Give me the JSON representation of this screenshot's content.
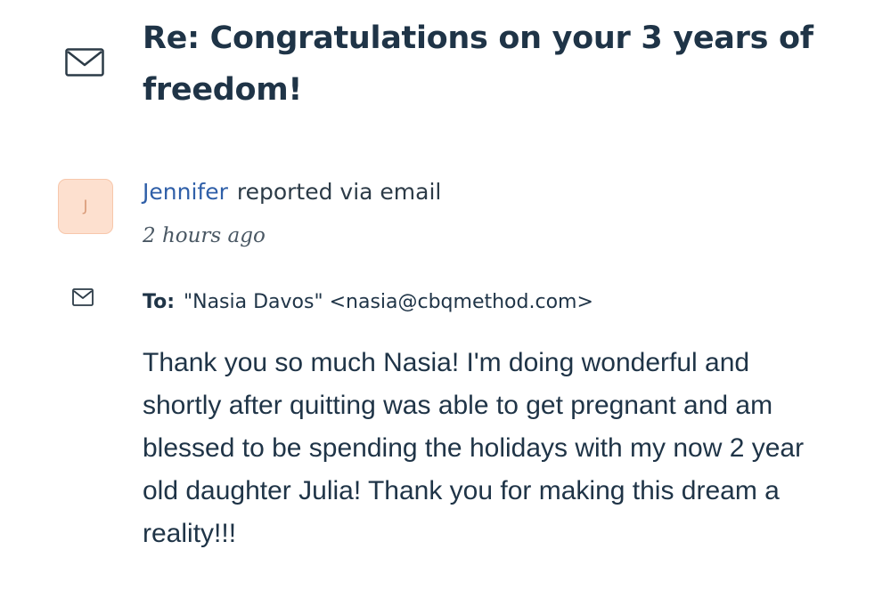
{
  "ticket": {
    "icon": "envelope-icon",
    "subject": "Re: Congratulations on your 3 years of freedom!"
  },
  "author": {
    "avatar_initial": "J",
    "name": "Jennifer",
    "action": "reported via email",
    "timestamp": "2 hours ago"
  },
  "email": {
    "icon": "envelope-icon",
    "to_label": "To:",
    "to_value": "\"Nasia Davos\" <nasia@cbqmethod.com>",
    "body": "Thank you so much Nasia! I'm doing wonderful and shortly after quitting was able to get pregnant and am blessed to be spending the holidays with my now 2 year old daughter Julia! Thank you for making this dream a reality!!!"
  },
  "colors": {
    "text": "#1f3447",
    "author_link": "#2f5fa8",
    "avatar_bg": "#fde0cf",
    "avatar_text": "#d99a78"
  }
}
